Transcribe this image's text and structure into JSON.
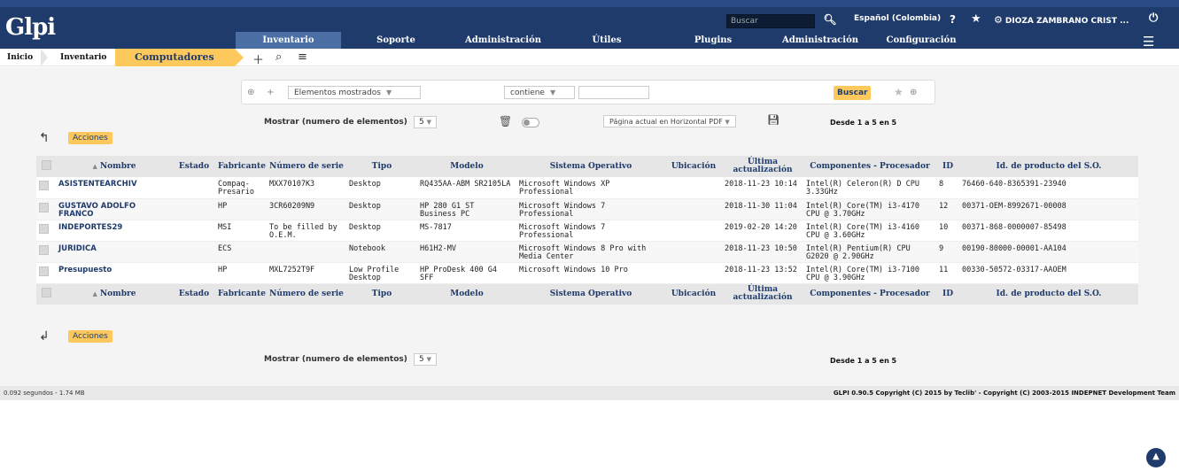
{
  "header": {
    "logo": "Glpi",
    "search_placeholder": "Buscar",
    "language": "Español (Colombia)",
    "help": "?",
    "user": "DIOZA ZAMBRANO CRIST ..."
  },
  "menu": [
    {
      "label": "Inventario",
      "active": true
    },
    {
      "label": "Soporte"
    },
    {
      "label": "Administración"
    },
    {
      "label": "Útiles"
    },
    {
      "label": "Plugins"
    },
    {
      "label": "Administración"
    },
    {
      "label": "Configuración"
    }
  ],
  "breadcrumb": {
    "items": [
      "Inicio",
      "Inventario"
    ],
    "current": "Computadores"
  },
  "search": {
    "field_select": "Elementos mostrados",
    "operator_select": "contiene",
    "button": "Buscar"
  },
  "toolbar": {
    "show_label": "Mostrar (numero de elementos)",
    "show_value": "5",
    "export_select": "Página actual en Horizontal PDF",
    "pager_info": "Desde 1 a 5 en 5",
    "actions": "Acciones"
  },
  "table": {
    "columns": [
      "Nombre",
      "Estado",
      "Fabricante",
      "Número de serie",
      "Tipo",
      "Modelo",
      "Sistema Operativo",
      "Ubicación",
      "Última actualización",
      "Componentes - Procesador",
      "ID",
      "Id. de producto del S.O."
    ],
    "rows": [
      {
        "name": "ASISTENTEARCHIV",
        "estado": "",
        "fabricante": "Compaq-Presario",
        "serie": "MXX70107K3",
        "tipo": "Desktop",
        "modelo": "RQ435AA-ABM SR2105LA",
        "so": "Microsoft Windows XP Professional",
        "ubicacion": "",
        "actualizacion": "2018-11-23 10:14",
        "procesador": "Intel(R) Celeron(R) D CPU 3.33GHz",
        "id": "8",
        "producto": "76460-640-8365391-23940"
      },
      {
        "name": "GUSTAVO ADOLFO FRANCO",
        "estado": "",
        "fabricante": "HP",
        "serie": "3CR60209N9",
        "tipo": "Desktop",
        "modelo": "HP 280 G1 ST Business PC",
        "so": "Microsoft Windows 7 Professional",
        "ubicacion": "",
        "actualizacion": "2018-11-30 11:04",
        "procesador": "Intel(R) Core(TM) i3-4170 CPU @ 3.70GHz",
        "id": "12",
        "producto": "00371-OEM-8992671-00008"
      },
      {
        "name": "INDEPORTES29",
        "estado": "",
        "fabricante": "MSI",
        "serie": "To be filled by O.E.M.",
        "tipo": "Desktop",
        "modelo": "MS-7817",
        "so": "Microsoft Windows 7 Professional",
        "ubicacion": "",
        "actualizacion": "2019-02-20 14:20",
        "procesador": "Intel(R) Core(TM) i3-4160 CPU @ 3.60GHz",
        "id": "10",
        "producto": "00371-868-0000007-85498"
      },
      {
        "name": "JURIDICA",
        "estado": "",
        "fabricante": "ECS",
        "serie": "",
        "tipo": "Notebook",
        "modelo": "H61H2-MV",
        "so": "Microsoft Windows 8 Pro with Media Center",
        "ubicacion": "",
        "actualizacion": "2018-11-23 10:50",
        "procesador": "Intel(R) Pentium(R) CPU G2020 @ 2.90GHz",
        "id": "9",
        "producto": "00190-80000-00001-AA104"
      },
      {
        "name": "Presupuesto",
        "estado": "",
        "fabricante": "HP",
        "serie": "MXL7252T9F",
        "tipo": "Low Profile Desktop",
        "modelo": "HP ProDesk 400 G4 SFF",
        "so": "Microsoft Windows 10 Pro",
        "ubicacion": "",
        "actualizacion": "2018-11-23 13:52",
        "procesador": "Intel(R) Core(TM) i3-7100 CPU @ 3.90GHz",
        "id": "11",
        "producto": "00330-50572-03317-AAOEM"
      }
    ]
  },
  "footer": {
    "left": "0.092 segundos - 1.74 MB",
    "right": "GLPI 0.90.5 Copyright (C) 2015 by Teclib' - Copyright (C) 2003-2015 INDEPNET Development Team"
  },
  "colors": {
    "header_bg": "#1f3b6b",
    "accent": "#fec95c",
    "active_menu": "#4b6fa5"
  }
}
